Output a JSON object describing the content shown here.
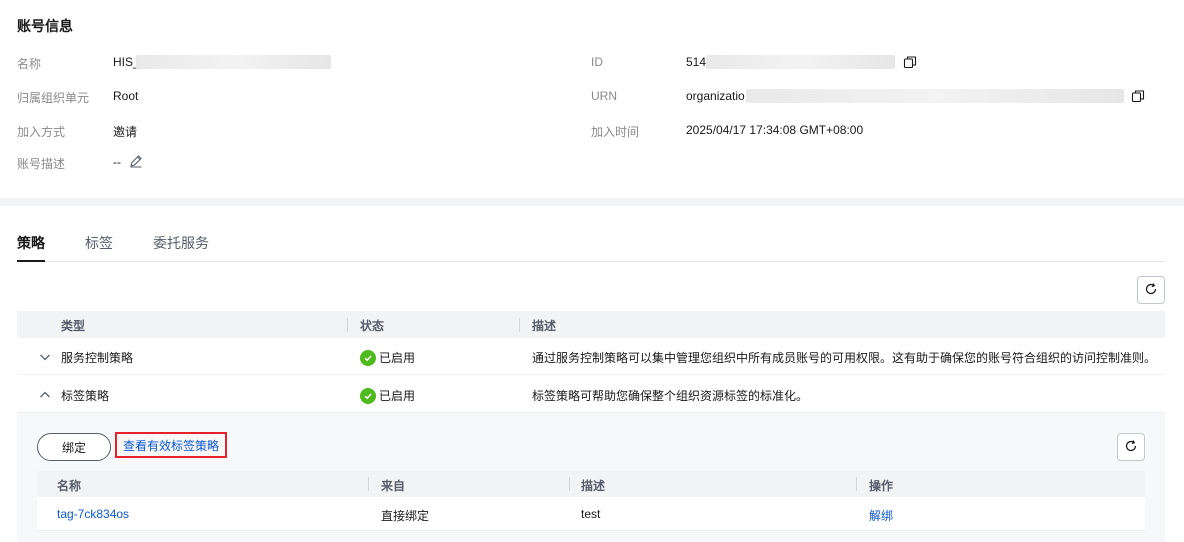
{
  "account_info": {
    "title": "账号信息",
    "name_label": "名称",
    "name_value": "HIS_",
    "org_unit_label": "归属组织单元",
    "org_unit_value": "Root",
    "join_method_label": "加入方式",
    "join_method_value": "邀请",
    "desc_label": "账号描述",
    "desc_value": "--",
    "id_label": "ID",
    "id_value": "514",
    "urn_label": "URN",
    "urn_value": "organizatio",
    "join_time_label": "加入时间",
    "join_time_value": "2025/04/17 17:34:08 GMT+08:00"
  },
  "tabs": [
    {
      "label": "策略",
      "active": true
    },
    {
      "label": "标签",
      "active": false
    },
    {
      "label": "委托服务",
      "active": false
    }
  ],
  "policy_table": {
    "columns": [
      "类型",
      "状态",
      "描述"
    ],
    "rows": [
      {
        "type": "服务控制策略",
        "status": "已启用",
        "description": "通过服务控制策略可以集中管理您组织中所有成员账号的可用权限。这有助于确保您的账号符合组织的访问控制准则。",
        "expanded": false
      },
      {
        "type": "标签策略",
        "status": "已启用",
        "description": "标签策略可帮助您确保整个组织资源标签的标准化。",
        "expanded": true
      }
    ]
  },
  "expanded_panel": {
    "bind_button": "绑定",
    "view_effective_link": "查看有效标签策略",
    "columns": [
      "名称",
      "来自",
      "描述",
      "操作"
    ],
    "rows": [
      {
        "name": "tag-7ck834os",
        "source": "直接绑定",
        "description": "test",
        "action": "解绑"
      }
    ]
  },
  "colors": {
    "accent_link": "#0c58d6",
    "status_enabled": "#50b91d",
    "highlight_border": "#e8202a"
  },
  "icons": [
    "copy-icon",
    "edit-icon",
    "refresh-icon",
    "chevron-down-icon",
    "chevron-up-icon",
    "check-circle-icon"
  ]
}
